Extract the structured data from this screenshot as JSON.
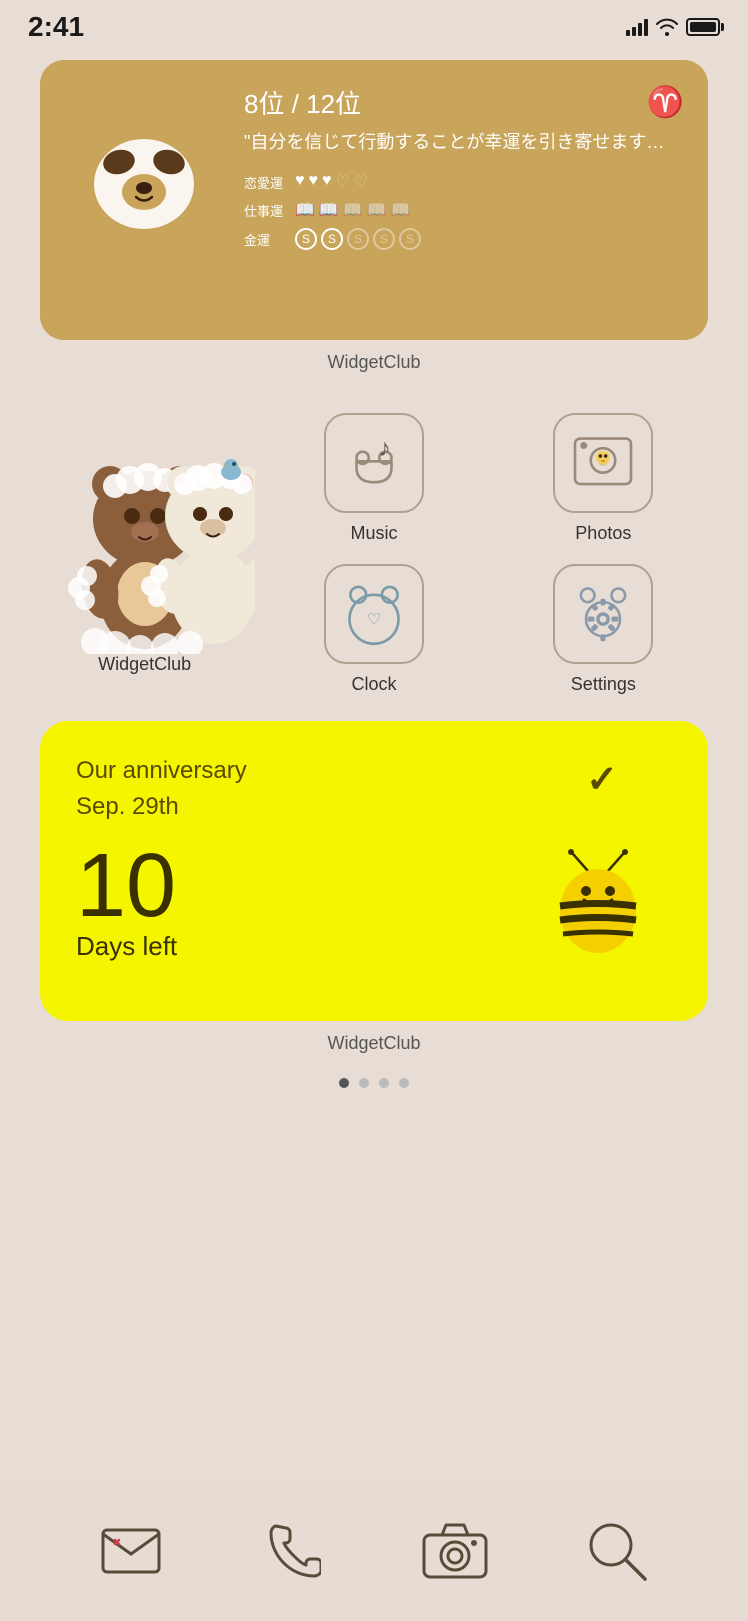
{
  "statusBar": {
    "time": "2:41",
    "battery": "full"
  },
  "widget1": {
    "rank": "8位 / 12位",
    "quote": "\"自分を信じて行動することが幸運を引き寄せます…",
    "loveLabel": "恋愛運",
    "workLabel": "仕事運",
    "moneyLabel": "金運",
    "label": "WidgetClub"
  },
  "apps": [
    {
      "id": "music",
      "label": "Music"
    },
    {
      "id": "photos",
      "label": "Photos"
    },
    {
      "id": "rilakkuma",
      "label": "WidgetClub"
    },
    {
      "id": "clock",
      "label": "Clock"
    },
    {
      "id": "settings",
      "label": "Settings"
    }
  ],
  "widget2": {
    "title": "Our anniversary\nSep. 29th",
    "days": "10",
    "daysLabel": "Days left",
    "label": "WidgetClub"
  },
  "dock": {
    "mail": "mail",
    "phone": "phone",
    "camera": "camera",
    "search": "search"
  }
}
